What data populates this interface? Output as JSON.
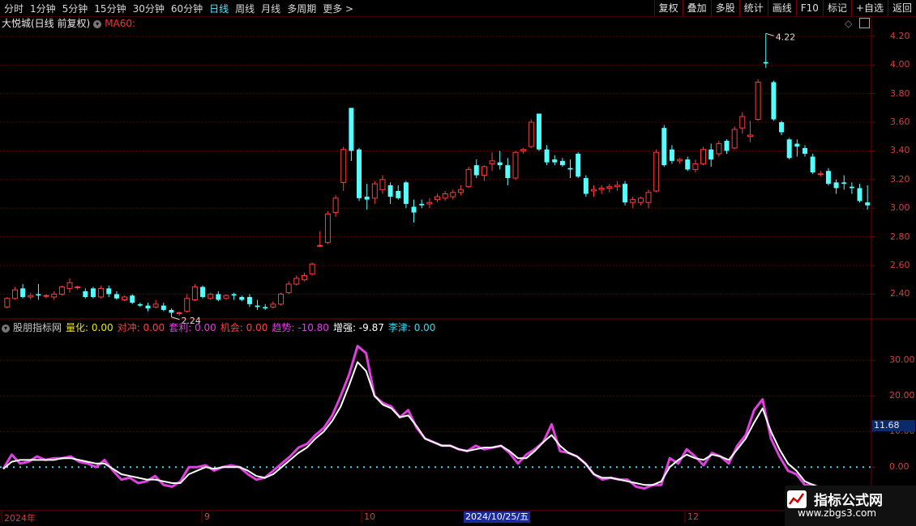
{
  "toolbar": {
    "periods": [
      "分时",
      "1分钟",
      "5分钟",
      "15分钟",
      "30分钟",
      "60分钟",
      "日线",
      "周线",
      "月线",
      "多周期",
      "更多 >"
    ],
    "active_period": "日线",
    "right_buttons": [
      "复权",
      "叠加",
      "多股",
      "统计",
      "画线",
      "F10",
      "标记",
      "+自选",
      "返回"
    ]
  },
  "main_panel": {
    "title": "大悦城(日线 前复权)",
    "ma_label": "MA60:",
    "high_label": "4.22",
    "low_label": "2.24",
    "price_ticks": [
      "4.20",
      "4.00",
      "3.80",
      "3.60",
      "3.40",
      "3.20",
      "3.00",
      "2.80",
      "2.60",
      "2.40"
    ]
  },
  "indicator_panel": {
    "name": "股朋指标网",
    "items": [
      {
        "label": "量化:",
        "value": "0.00",
        "color": "#e8e800"
      },
      {
        "label": "对冲:",
        "value": "0.00",
        "color": "#ff4040"
      },
      {
        "label": "套利:",
        "value": "0.00",
        "color": "#e040e0"
      },
      {
        "label": "机会:",
        "value": "0.00",
        "color": "#ff4040"
      },
      {
        "label": "趋势:",
        "value": "-10.80",
        "color": "#e040e0"
      },
      {
        "label": "增强:",
        "value": "-9.87",
        "color": "#ffffff"
      },
      {
        "label": "李津:",
        "value": "0.00",
        "color": "#40d8e8"
      }
    ],
    "axis_ticks": [
      "30.00",
      "20.00",
      "10.00",
      "0.00"
    ],
    "current_value": "11.68"
  },
  "date_axis": {
    "labels": [
      "2024年",
      "9",
      "10",
      "12"
    ],
    "highlight": "2024/10/25/五"
  },
  "watermark": {
    "title": "指标公式网",
    "url": "www.zbgs3.com"
  },
  "colors": {
    "up": "#ff3c3c",
    "down": "#54ffff",
    "grid": "#7a0000",
    "trend": "#e040e0",
    "enhance": "#ffffff",
    "zero_line": "#40d8e8"
  },
  "chart_data": [
    {
      "type": "candlestick",
      "title": "大悦城(日线 前复权)",
      "ylim": [
        2.25,
        4.25
      ],
      "ohlc": [
        [
          2.31,
          2.38,
          2.3,
          2.37
        ],
        [
          2.37,
          2.45,
          2.36,
          2.43
        ],
        [
          2.44,
          2.47,
          2.37,
          2.38
        ],
        [
          2.38,
          2.41,
          2.36,
          2.39
        ],
        [
          2.4,
          2.47,
          2.36,
          2.39
        ],
        [
          2.39,
          2.4,
          2.37,
          2.39
        ],
        [
          2.38,
          2.42,
          2.36,
          2.4
        ],
        [
          2.4,
          2.46,
          2.39,
          2.45
        ],
        [
          2.44,
          2.51,
          2.41,
          2.48
        ],
        [
          2.45,
          2.46,
          2.43,
          2.45
        ],
        [
          2.42,
          2.44,
          2.37,
          2.38
        ],
        [
          2.44,
          2.45,
          2.37,
          2.38
        ],
        [
          2.38,
          2.46,
          2.37,
          2.44
        ],
        [
          2.44,
          2.46,
          2.38,
          2.4
        ],
        [
          2.4,
          2.42,
          2.36,
          2.37
        ],
        [
          2.36,
          2.39,
          2.35,
          2.38
        ],
        [
          2.39,
          2.4,
          2.33,
          2.34
        ],
        [
          2.33,
          2.34,
          2.31,
          2.32
        ],
        [
          2.32,
          2.34,
          2.28,
          2.3
        ],
        [
          2.31,
          2.36,
          2.3,
          2.33
        ],
        [
          2.32,
          2.34,
          2.28,
          2.29
        ],
        [
          2.29,
          2.3,
          2.24,
          2.27
        ],
        [
          2.27,
          2.28,
          2.25,
          2.27
        ],
        [
          2.28,
          2.4,
          2.27,
          2.37
        ],
        [
          2.36,
          2.47,
          2.35,
          2.45
        ],
        [
          2.45,
          2.46,
          2.37,
          2.38
        ],
        [
          2.37,
          2.41,
          2.36,
          2.4
        ],
        [
          2.4,
          2.42,
          2.35,
          2.36
        ],
        [
          2.37,
          2.4,
          2.36,
          2.39
        ],
        [
          2.4,
          2.41,
          2.36,
          2.39
        ],
        [
          2.38,
          2.39,
          2.35,
          2.36
        ],
        [
          2.38,
          2.4,
          2.31,
          2.33
        ],
        [
          2.32,
          2.36,
          2.29,
          2.31
        ],
        [
          2.31,
          2.33,
          2.29,
          2.3
        ],
        [
          2.31,
          2.35,
          2.3,
          2.33
        ],
        [
          2.33,
          2.41,
          2.32,
          2.4
        ],
        [
          2.41,
          2.49,
          2.4,
          2.47
        ],
        [
          2.47,
          2.53,
          2.46,
          2.51
        ],
        [
          2.5,
          2.55,
          2.49,
          2.53
        ],
        [
          2.54,
          2.62,
          2.53,
          2.61
        ],
        [
          2.74,
          2.84,
          2.73,
          2.74
        ],
        [
          2.76,
          2.98,
          2.75,
          2.96
        ],
        [
          2.97,
          3.09,
          2.94,
          3.07
        ],
        [
          3.18,
          3.43,
          3.12,
          3.41
        ],
        [
          3.7,
          3.7,
          3.33,
          3.4
        ],
        [
          3.41,
          3.42,
          3.05,
          3.07
        ],
        [
          3.08,
          3.17,
          2.99,
          3.06
        ],
        [
          3.07,
          3.19,
          3.03,
          3.17
        ],
        [
          3.13,
          3.23,
          3.1,
          3.2
        ],
        [
          3.16,
          3.18,
          3.03,
          3.08
        ],
        [
          3.12,
          3.16,
          3.06,
          3.07
        ],
        [
          3.18,
          3.19,
          3.0,
          3.03
        ],
        [
          3.01,
          3.06,
          2.9,
          2.97
        ],
        [
          3.03,
          3.06,
          3.0,
          3.02
        ],
        [
          3.03,
          3.07,
          3.0,
          3.04
        ],
        [
          3.06,
          3.1,
          3.04,
          3.08
        ],
        [
          3.07,
          3.12,
          3.05,
          3.1
        ],
        [
          3.08,
          3.13,
          3.06,
          3.11
        ],
        [
          3.11,
          3.16,
          3.09,
          3.13
        ],
        [
          3.15,
          3.29,
          3.14,
          3.27
        ],
        [
          3.3,
          3.34,
          3.21,
          3.23
        ],
        [
          3.23,
          3.3,
          3.19,
          3.29
        ],
        [
          3.31,
          3.39,
          3.26,
          3.33
        ],
        [
          3.32,
          3.4,
          3.27,
          3.3
        ],
        [
          3.3,
          3.35,
          3.16,
          3.21
        ],
        [
          3.21,
          3.4,
          3.2,
          3.39
        ],
        [
          3.4,
          3.42,
          3.38,
          3.41
        ],
        [
          3.43,
          3.62,
          3.42,
          3.6
        ],
        [
          3.66,
          3.66,
          3.4,
          3.41
        ],
        [
          3.41,
          3.44,
          3.3,
          3.32
        ],
        [
          3.34,
          3.37,
          3.3,
          3.32
        ],
        [
          3.33,
          3.35,
          3.29,
          3.3
        ],
        [
          3.28,
          3.34,
          3.21,
          3.27
        ],
        [
          3.38,
          3.39,
          3.21,
          3.22
        ],
        [
          3.21,
          3.23,
          3.08,
          3.1
        ],
        [
          3.12,
          3.16,
          3.08,
          3.13
        ],
        [
          3.13,
          3.16,
          3.1,
          3.14
        ],
        [
          3.14,
          3.17,
          3.11,
          3.15
        ],
        [
          3.15,
          3.19,
          3.12,
          3.16
        ],
        [
          3.17,
          3.19,
          3.02,
          3.04
        ],
        [
          3.04,
          3.08,
          3.0,
          3.06
        ],
        [
          3.04,
          3.08,
          3.02,
          3.07
        ],
        [
          3.04,
          3.13,
          3.0,
          3.11
        ],
        [
          3.12,
          3.41,
          3.11,
          3.39
        ],
        [
          3.56,
          3.58,
          3.29,
          3.3
        ],
        [
          3.41,
          3.44,
          3.31,
          3.33
        ],
        [
          3.33,
          3.35,
          3.31,
          3.34
        ],
        [
          3.34,
          3.36,
          3.26,
          3.27
        ],
        [
          3.27,
          3.34,
          3.25,
          3.31
        ],
        [
          3.31,
          3.43,
          3.3,
          3.41
        ],
        [
          3.41,
          3.45,
          3.29,
          3.34
        ],
        [
          3.38,
          3.47,
          3.36,
          3.45
        ],
        [
          3.47,
          3.48,
          3.38,
          3.4
        ],
        [
          3.42,
          3.57,
          3.41,
          3.55
        ],
        [
          3.56,
          3.67,
          3.52,
          3.64
        ],
        [
          3.5,
          3.61,
          3.46,
          3.51
        ],
        [
          3.62,
          3.9,
          3.61,
          3.88
        ],
        [
          4.02,
          4.22,
          3.98,
          4.01
        ],
        [
          3.88,
          3.89,
          3.61,
          3.62
        ],
        [
          3.6,
          3.61,
          3.51,
          3.53
        ],
        [
          3.48,
          3.49,
          3.34,
          3.35
        ],
        [
          3.45,
          3.48,
          3.36,
          3.43
        ],
        [
          3.42,
          3.44,
          3.36,
          3.38
        ],
        [
          3.36,
          3.38,
          3.24,
          3.25
        ],
        [
          3.24,
          3.26,
          3.22,
          3.24
        ],
        [
          3.26,
          3.28,
          3.16,
          3.17
        ],
        [
          3.18,
          3.2,
          3.1,
          3.14
        ],
        [
          3.18,
          3.23,
          3.13,
          3.17
        ],
        [
          3.15,
          3.18,
          3.1,
          3.14
        ],
        [
          3.14,
          3.17,
          3.04,
          3.05
        ],
        [
          3.04,
          3.16,
          2.99,
          3.02
        ]
      ]
    },
    {
      "type": "line",
      "title": "股朋指标网",
      "ylim": [
        -12,
        38
      ],
      "series": [
        {
          "name": "趋势",
          "values": [
            -0.5,
            3.5,
            1,
            1.5,
            3,
            2,
            2.5,
            2.5,
            3,
            1.5,
            1,
            0,
            2,
            -1,
            -3.5,
            -3,
            -4.5,
            -4,
            -2.5,
            -5,
            -5.5,
            -4,
            0,
            0,
            0.5,
            -1,
            0,
            0.5,
            0,
            -2,
            -3.5,
            -3,
            -1,
            1,
            3,
            5.5,
            6.5,
            9,
            11,
            14.5,
            20,
            26,
            34,
            32,
            20,
            18,
            17,
            14,
            16,
            11,
            8,
            7,
            6,
            6,
            5,
            4.5,
            6,
            5,
            5.5,
            6,
            4,
            1,
            3.5,
            5,
            7,
            12,
            4.5,
            4,
            3,
            1,
            -2,
            -3.5,
            -3,
            -3.5,
            -3.5,
            -5.5,
            -6,
            -5,
            -5,
            2.5,
            1,
            5,
            3,
            0.5,
            4,
            3,
            1,
            6,
            9,
            16,
            19,
            8,
            3,
            -1,
            -2,
            -5,
            -5,
            -6,
            -8
          ]
        },
        {
          "name": "增强",
          "values": [
            -0.5,
            1.5,
            2,
            2,
            2,
            2,
            2,
            2.5,
            2.5,
            2,
            1.5,
            1,
            1,
            -0.5,
            -2,
            -2.5,
            -3,
            -3.5,
            -3.5,
            -4,
            -4.5,
            -4.5,
            -2,
            -1,
            0,
            -0.5,
            0,
            0,
            0,
            -1,
            -2.5,
            -3,
            -2,
            0,
            2,
            4,
            5.5,
            8,
            10,
            13,
            17,
            23,
            29.5,
            27,
            20,
            17.5,
            16.5,
            14,
            14.5,
            11.5,
            8,
            7,
            6,
            6,
            5,
            4.5,
            5,
            5.5,
            5.5,
            6,
            4.5,
            2.5,
            2.5,
            4.5,
            7,
            9,
            6,
            4,
            3,
            1,
            -2,
            -3,
            -3,
            -3.5,
            -4,
            -4.5,
            -5,
            -5,
            -4,
            0,
            2,
            3.5,
            2.5,
            2,
            3.5,
            3,
            2,
            5,
            8,
            12.5,
            16.5,
            10,
            5,
            1,
            -1,
            -4,
            -5,
            -6,
            -8
          ]
        }
      ]
    }
  ]
}
